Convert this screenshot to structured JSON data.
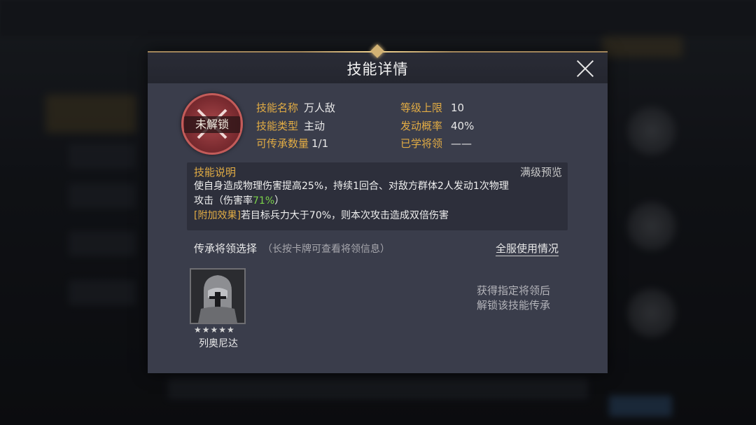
{
  "dialog": {
    "title": "技能详情"
  },
  "skill": {
    "locked_label": "未解锁",
    "fields": {
      "name_key": "技能名称",
      "name_val": "万人敌",
      "type_key": "技能类型",
      "type_val": "主动",
      "count_key": "可传承数量",
      "count_val": "1/1",
      "level_key": "等级上限",
      "level_val": "10",
      "chance_key": "发动概率",
      "chance_val": "40%",
      "learned_key": "已学将领",
      "learned_val": "——"
    }
  },
  "description": {
    "title": "技能说明",
    "max_preview": "满级预览",
    "line1": "使自身造成物理伤害提高25%，持续1回合、对敌方群体2人发动1次物理",
    "line2_prefix": "攻击（伤害率",
    "line2_rate": "71%",
    "line2_suffix": "）",
    "line3_tag": "[附加效果]",
    "line3_text": "若目标兵力大于70%，则本次攻击造成双倍伤害"
  },
  "inherit": {
    "title": "传承将领选择",
    "hint": "（长按卡牌可查看将领信息）",
    "server_link": "全服使用情况",
    "general_name": "列奥尼达",
    "stars": "★★★★★",
    "unlock_hint_1": "获得指定将领后",
    "unlock_hint_2": "解锁该技能传承"
  },
  "colors": {
    "accent_gold": "#e2ac44",
    "rate_green": "#7bd24a",
    "panel": "#3a3d4b"
  }
}
